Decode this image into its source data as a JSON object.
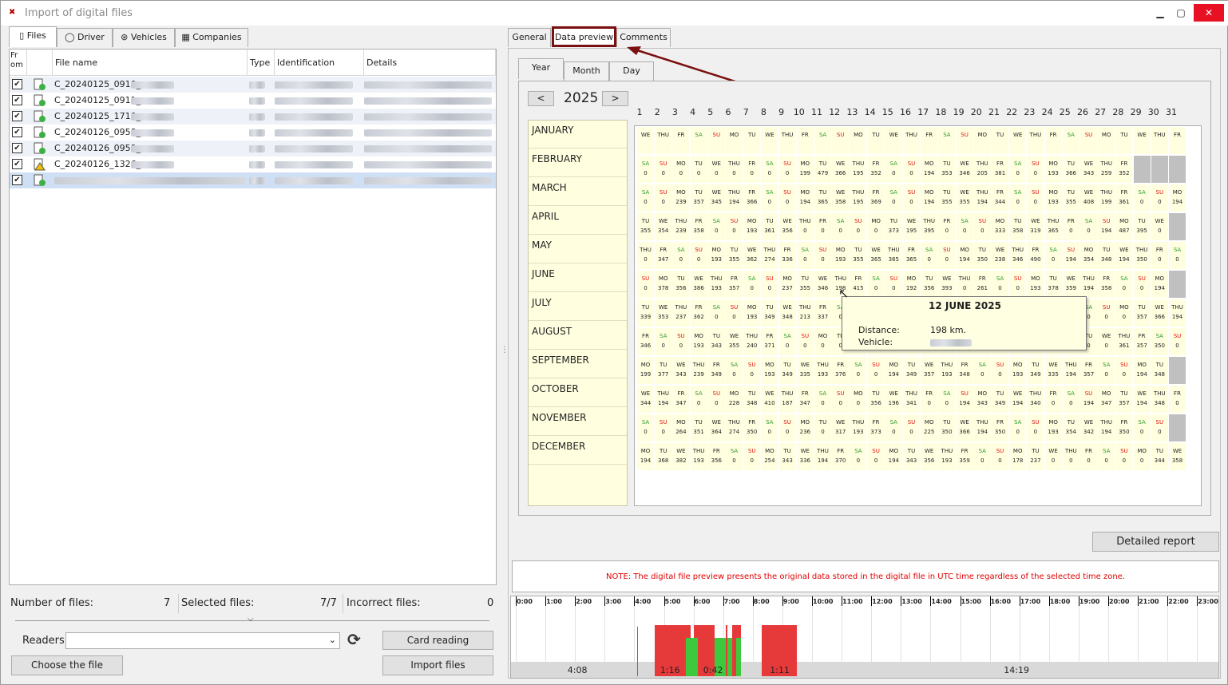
{
  "window": {
    "title": "Import of digital files",
    "minimize": "▁",
    "maximize": "▢",
    "close": "✕"
  },
  "left_tabs": [
    {
      "label": "Files",
      "icon": "file-icon"
    },
    {
      "label": "Driver",
      "icon": "person-icon"
    },
    {
      "label": "Vehicles",
      "icon": "wheel-icon"
    },
    {
      "label": "Companies",
      "icon": "building-icon"
    }
  ],
  "grid": {
    "columns": [
      "Fr om",
      "File name",
      "Type",
      "Identification",
      "Details"
    ],
    "rows": [
      {
        "name": "C_20240125_0910_",
        "status": "ok"
      },
      {
        "name": "C_20240125_0911_",
        "status": "ok"
      },
      {
        "name": "C_20240125_1710_",
        "status": "ok"
      },
      {
        "name": "C_20240126_0958_",
        "status": "ok"
      },
      {
        "name": "C_20240126_0959_",
        "status": "ok"
      },
      {
        "name": "C_20240126_1326_",
        "status": "warning"
      },
      {
        "name": "",
        "status": "ok",
        "selected": true
      }
    ]
  },
  "stats": {
    "files_label": "Number of files:",
    "files_value": "7",
    "selected_label": "Selected files:",
    "selected_value": "7/7",
    "incorrect_label": "Incorrect files:",
    "incorrect_value": "0"
  },
  "readers": {
    "label": "Readers",
    "value": ""
  },
  "buttons": {
    "card_reading": "Card reading",
    "choose_file": "Choose the file",
    "import_files": "Import files",
    "detailed_report": "Detailed report"
  },
  "right_tabs": [
    "General",
    "Data preview",
    "Comments"
  ],
  "sub_tabs": [
    "Year",
    "Month",
    "Day"
  ],
  "year_nav": {
    "prev": "<",
    "year": "2025",
    "next": ">"
  },
  "months": [
    "JANUARY",
    "FEBRUARY",
    "MARCH",
    "APRIL",
    "MAY",
    "JUNE",
    "JULY",
    "AUGUST",
    "SEPTEMBER",
    "OCTOBER",
    "NOVEMBER",
    "DECEMBER"
  ],
  "day_numbers": [
    "1",
    "2",
    "3",
    "4",
    "5",
    "6",
    "7",
    "8",
    "9",
    "10",
    "11",
    "12",
    "13",
    "14",
    "15",
    "16",
    "17",
    "18",
    "19",
    "20",
    "21",
    "22",
    "23",
    "24",
    "25",
    "26",
    "27",
    "28",
    "29",
    "30",
    "31"
  ],
  "calendar": [
    {
      "start": 2,
      "len": 31,
      "km": []
    },
    {
      "start": 5,
      "len": 28,
      "km": [
        "0",
        "0",
        "0",
        "0",
        "0",
        "0",
        "0",
        "0",
        "0",
        "199",
        "479",
        "366",
        "195",
        "352",
        "0",
        "0",
        "194",
        "353",
        "346",
        "205",
        "381",
        "0",
        "0",
        "193",
        "366",
        "343",
        "259",
        "352"
      ]
    },
    {
      "start": 5,
      "len": 31,
      "km": [
        "0",
        "0",
        "239",
        "357",
        "345",
        "194",
        "366",
        "0",
        "0",
        "194",
        "365",
        "358",
        "195",
        "369",
        "0",
        "0",
        "194",
        "355",
        "355",
        "194",
        "344",
        "0",
        "0",
        "193",
        "355",
        "408",
        "199",
        "361",
        "0",
        "0",
        "194"
      ]
    },
    {
      "start": 1,
      "len": 30,
      "km": [
        "355",
        "354",
        "239",
        "358",
        "0",
        "0",
        "193",
        "361",
        "356",
        "0",
        "0",
        "0",
        "0",
        "0",
        "373",
        "195",
        "395",
        "0",
        "0",
        "0",
        "333",
        "358",
        "319",
        "365",
        "0",
        "0",
        "194",
        "487",
        "395",
        "0"
      ]
    },
    {
      "start": 3,
      "len": 31,
      "km": [
        "0",
        "347",
        "0",
        "0",
        "193",
        "355",
        "362",
        "274",
        "336",
        "0",
        "0",
        "193",
        "355",
        "365",
        "365",
        "365",
        "0",
        "0",
        "194",
        "350",
        "238",
        "346",
        "490",
        "0",
        "194",
        "354",
        "348",
        "194",
        "350",
        "0",
        "0"
      ]
    },
    {
      "start": 6,
      "len": 30,
      "km": [
        "0",
        "378",
        "356",
        "386",
        "193",
        "357",
        "0",
        "0",
        "237",
        "355",
        "346",
        "198",
        "415",
        "0",
        "0",
        "192",
        "356",
        "393",
        "0",
        "261",
        "0",
        "0",
        "193",
        "378",
        "359",
        "194",
        "358",
        "0",
        "0",
        "194"
      ]
    },
    {
      "start": 1,
      "len": 31,
      "km": [
        "339",
        "353",
        "237",
        "362",
        "0",
        "0",
        "193",
        "349",
        "348",
        "213",
        "337",
        "0",
        "0",
        "0",
        "0",
        "0",
        "0",
        "0",
        "0",
        "0",
        "0",
        "0",
        "0",
        "0",
        "0",
        "0",
        "0",
        "0",
        "357",
        "366",
        "194"
      ]
    },
    {
      "start": 4,
      "len": 31,
      "km": [
        "346",
        "0",
        "0",
        "193",
        "343",
        "355",
        "240",
        "371",
        "0",
        "0",
        "0",
        "0",
        "0",
        "0",
        "0",
        "0",
        "0",
        "0",
        "0",
        "0",
        "0",
        "0",
        "0",
        "0",
        "0",
        "0",
        "0",
        "361",
        "357",
        "350",
        "0"
      ]
    },
    {
      "start": 0,
      "len": 30,
      "km": [
        "199",
        "377",
        "343",
        "239",
        "349",
        "0",
        "0",
        "193",
        "349",
        "335",
        "193",
        "376",
        "0",
        "0",
        "194",
        "349",
        "357",
        "193",
        "348",
        "0",
        "0",
        "193",
        "349",
        "335",
        "194",
        "357",
        "0",
        "0",
        "194",
        "348"
      ]
    },
    {
      "start": 2,
      "len": 31,
      "km": [
        "344",
        "194",
        "347",
        "0",
        "0",
        "228",
        "348",
        "410",
        "187",
        "347",
        "0",
        "0",
        "0",
        "356",
        "196",
        "341",
        "0",
        "0",
        "194",
        "343",
        "349",
        "194",
        "340",
        "0",
        "0",
        "194",
        "347",
        "357",
        "194",
        "348",
        "0"
      ]
    },
    {
      "start": 5,
      "len": 30,
      "km": [
        "0",
        "0",
        "264",
        "351",
        "364",
        "274",
        "350",
        "0",
        "0",
        "236",
        "0",
        "317",
        "193",
        "373",
        "0",
        "0",
        "225",
        "350",
        "366",
        "194",
        "350",
        "0",
        "0",
        "193",
        "354",
        "342",
        "194",
        "350",
        "0",
        "0"
      ]
    },
    {
      "start": 0,
      "len": 31,
      "km": [
        "194",
        "368",
        "382",
        "193",
        "356",
        "0",
        "0",
        "254",
        "343",
        "336",
        "194",
        "370",
        "0",
        "0",
        "194",
        "343",
        "356",
        "193",
        "359",
        "0",
        "0",
        "178",
        "237",
        "0",
        "0",
        "0",
        "0",
        "0",
        "0",
        "344",
        "358"
      ]
    }
  ],
  "weekdays": [
    "MO",
    "TU",
    "WE",
    "THU",
    "FR",
    "SA",
    "SU"
  ],
  "tooltip": {
    "title": "12 JUNE 2025",
    "distance_label": "Distance:",
    "distance_value": "198 km.",
    "vehicle_label": "Vehicle:",
    "vehicle_value": ""
  },
  "note": "NOTE: The digital file preview presents the original data stored in the digital file in UTC time regardless of the selected time zone.",
  "timeline": {
    "hours": [
      "0:00",
      "1:00",
      "2:00",
      "3:00",
      "4:00",
      "5:00",
      "6:00",
      "7:00",
      "8:00",
      "9:00",
      "10:00",
      "11:00",
      "12:00",
      "13:00",
      "14:00",
      "15:00",
      "16:00",
      "17:00",
      "18:00",
      "19:00",
      "20:00",
      "21:00",
      "22:00",
      "23:00"
    ],
    "durations": [
      {
        "label": "4:08",
        "center_hour": 2.07
      },
      {
        "label": "1:16",
        "center_hour": 5.2
      },
      {
        "label": "0:42",
        "center_hour": 6.65
      },
      {
        "label": "1:11",
        "center_hour": 8.9
      },
      {
        "label": "14:19",
        "center_hour": 16.8
      }
    ],
    "driving": [
      [
        4.7,
        5.9
      ],
      [
        6.0,
        6.7
      ],
      [
        7.1,
        7.15
      ],
      [
        7.3,
        7.6
      ],
      [
        8.3,
        9.5
      ]
    ],
    "other_work": [
      [
        5.75,
        6.15
      ],
      [
        6.7,
        7.1
      ],
      [
        7.15,
        7.3
      ],
      [
        7.45,
        7.6
      ]
    ],
    "colors": {
      "driving": "#e63a3a",
      "work": "#3ec83e",
      "grey": "#d9d9d9",
      "weekend": "#2e9a2e",
      "sunday": "#e01010",
      "inactive": "#c0c0c0",
      "highlight": "#7b1010"
    }
  }
}
